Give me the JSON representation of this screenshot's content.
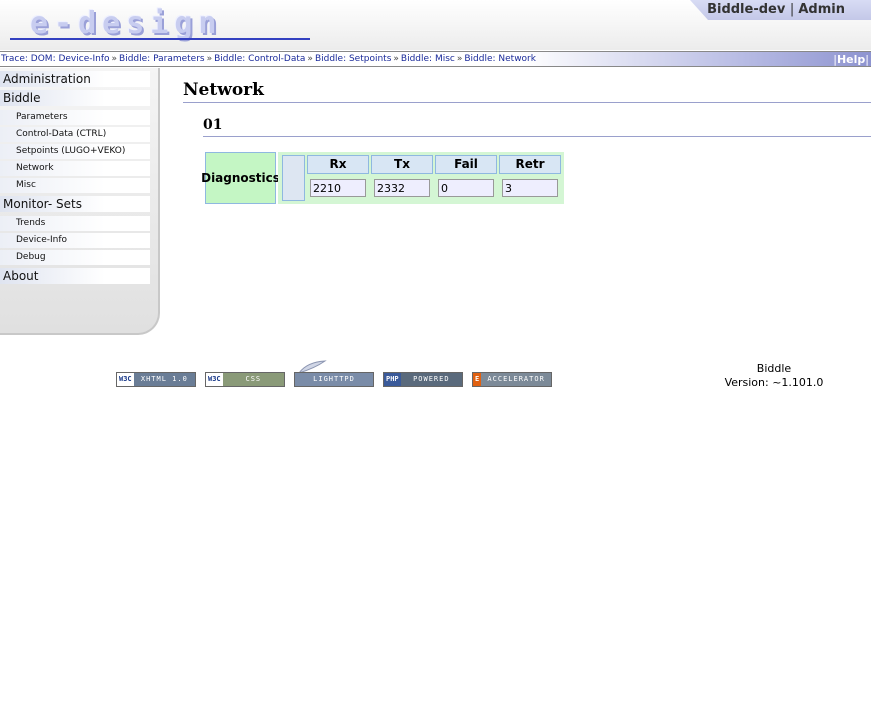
{
  "header": {
    "logo_text": "e-design",
    "user": "Biddle-dev",
    "role": "Admin"
  },
  "trace": {
    "prefix": "Trace:",
    "items": [
      "DOM: Device-Info",
      "Biddle: Parameters",
      "Biddle: Control-Data",
      "Biddle: Setpoints",
      "Biddle: Misc",
      "Biddle: Network"
    ],
    "help": "Help"
  },
  "sidebar": {
    "items": [
      {
        "label": "Administration"
      },
      {
        "label": "Biddle"
      },
      {
        "label": "Parameters"
      },
      {
        "label": "Control-Data (CTRL)"
      },
      {
        "label": "Setpoints (LUGO+VEKO)"
      },
      {
        "label": "Network"
      },
      {
        "label": "Misc"
      },
      {
        "label": "Monitor- Sets"
      },
      {
        "label": "Trends"
      },
      {
        "label": "Device-Info"
      },
      {
        "label": "Debug"
      },
      {
        "label": "About"
      }
    ]
  },
  "main": {
    "title": "Network",
    "section": "01",
    "diagnostics": {
      "label": "Diagnostics",
      "columns": [
        {
          "header": "Rx",
          "value": "2210"
        },
        {
          "header": "Tx",
          "value": "2332"
        },
        {
          "header": "Fail",
          "value": "0"
        },
        {
          "header": "Retr",
          "value": "3"
        }
      ]
    }
  },
  "footer": {
    "badges": [
      {
        "left": "W3C",
        "right": "XHTML 1.0",
        "color": "#6a7d96",
        "icon": "w3c-xhtml-icon"
      },
      {
        "left": "W3C",
        "right": "CSS",
        "color": "#8a9a78",
        "icon": "w3c-css-icon"
      },
      {
        "left": "",
        "right": "LIGHTTPD",
        "color": "#7a8ca8",
        "icon": "lighttpd-feather-icon"
      },
      {
        "left": "PHP",
        "right": "POWERED",
        "color": "#5a6a7c",
        "icon": "php-icon"
      },
      {
        "left": "E",
        "right": "ACCELERATOR",
        "color": "#7c8a98",
        "icon": "eaccelerator-icon"
      }
    ],
    "app_name": "Biddle",
    "version": "Version: ~1.101.0"
  }
}
